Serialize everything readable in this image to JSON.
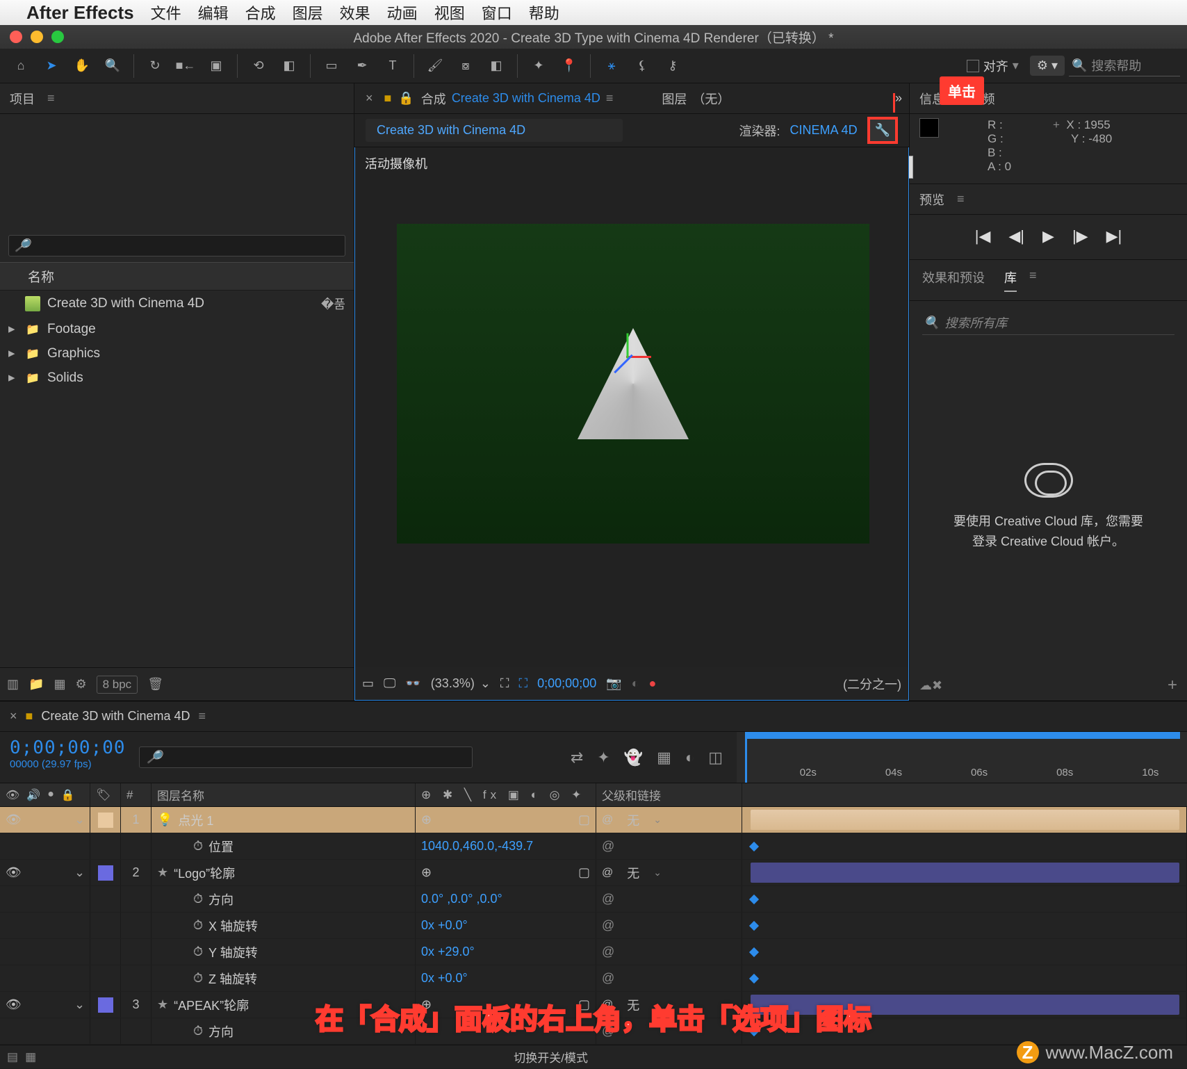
{
  "mac_menu": {
    "appname": "After Effects",
    "items": [
      "文件",
      "编辑",
      "合成",
      "图层",
      "效果",
      "动画",
      "视图",
      "窗口",
      "帮助"
    ]
  },
  "window": {
    "title": "Adobe After Effects 2020 - Create 3D Type with Cinema 4D Renderer（已转换） *"
  },
  "toolbar": {
    "align_label": "对齐",
    "search_help_placeholder": "搜索帮助"
  },
  "callouts": {
    "click_label": "单击",
    "tooltip_options": "选项",
    "instruction": "在「合成」面板的右上角，单击「选项」图标"
  },
  "project_panel": {
    "title": "项目",
    "search_placeholder": "",
    "name_header": "名称",
    "items": [
      {
        "kind": "comp",
        "label": "Create 3D with Cinema 4D",
        "icon": "comp"
      },
      {
        "kind": "folder",
        "label": "Footage",
        "icon": "folder"
      },
      {
        "kind": "folder",
        "label": "Graphics",
        "icon": "folder"
      },
      {
        "kind": "folder",
        "label": "Solids",
        "icon": "folder"
      }
    ],
    "footer": {
      "bpc": "8 bpc"
    }
  },
  "comp_viewer": {
    "tab_prefix": "合成",
    "tab_name": "Create 3D with Cinema 4D",
    "layer_dd_label": "图层",
    "layer_dd_value": "（无）",
    "crumb_name": "Create 3D with Cinema 4D",
    "renderer_label": "渲染器:",
    "renderer_value": "CINEMA 4D",
    "active_camera": "活动摄像机",
    "footer": {
      "zoom": "(33.3%)",
      "timecode": "0;00;00;00",
      "resolution": "(二分之一)"
    }
  },
  "right": {
    "info_tab": "信息",
    "audio_tab": "音频",
    "info": {
      "r": "R :",
      "g": "G :",
      "b": "B :",
      "a": "A : 0",
      "x": "X : 1955",
      "y": "Y :  -480"
    },
    "preview_tab": "预览",
    "eff_tab": "效果和预设",
    "lib_tab": "库",
    "lib_search_placeholder": "搜索所有库",
    "cc_msg_line1": "要使用 Creative Cloud 库，您需要",
    "cc_msg_line2": "登录 Creative Cloud 帐户。"
  },
  "timeline": {
    "tab_name": "Create 3D with Cinema 4D",
    "timecode": "0;00;00;00",
    "frame_info": "00000 (29.97 fps)",
    "ruler": [
      "02s",
      "04s",
      "06s",
      "08s",
      "10s"
    ],
    "col_layer_name": "图层名称",
    "col_parent": "父级和链接",
    "layers": [
      {
        "num": "1",
        "color": "c-peach",
        "icon": "light",
        "name": "点光 1",
        "parent": "无",
        "props": [
          {
            "name": "位置",
            "value": "1040.0,460.0,-439.7"
          }
        ],
        "bar": "peach",
        "selected": true
      },
      {
        "num": "2",
        "color": "c-blue",
        "icon": "star",
        "name": "“Logo”轮廓",
        "parent": "无",
        "props": [
          {
            "name": "方向",
            "value": "0.0°  ,0.0°  ,0.0°"
          },
          {
            "name": "X 轴旋转",
            "value": "0x +0.0°"
          },
          {
            "name": "Y 轴旋转",
            "value": "0x +29.0°"
          },
          {
            "name": "Z 轴旋转",
            "value": "0x +0.0°"
          }
        ],
        "bar": "blue"
      },
      {
        "num": "3",
        "color": "c-blue",
        "icon": "star",
        "name": "“APEAK”轮廓",
        "parent": "无",
        "props": [
          {
            "name": "方向",
            "value": ""
          }
        ],
        "bar": "blue"
      }
    ],
    "toggle_label": "切换开关/模式"
  },
  "watermark": "www.MacZ.com"
}
